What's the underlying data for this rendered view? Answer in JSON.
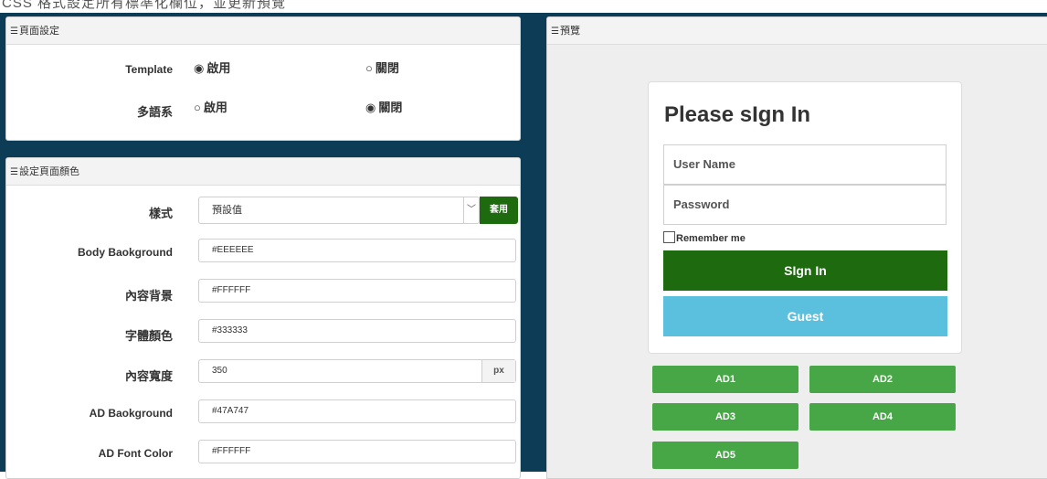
{
  "caption": "CSS 格式設定所有標準化欄位，並更新預覽",
  "page_settings": {
    "title": "頁面設定",
    "template_label": "Template",
    "template_options": [
      {
        "label": "啟用",
        "checked": true
      },
      {
        "label": "關閉",
        "checked": false
      }
    ],
    "multilang_label": "多語系",
    "multilang_options": [
      {
        "label": "啟用",
        "checked": false
      },
      {
        "label": "關閉",
        "checked": true
      }
    ]
  },
  "color_settings": {
    "title": "設定頁面顏色",
    "style_label": "樣式",
    "style_value": "預設值",
    "apply_label": "套用",
    "fields": [
      {
        "label": "Body Baokground",
        "value": "#EEEEEE"
      },
      {
        "label": "內容背景",
        "value": "#FFFFFF"
      },
      {
        "label": "字體顏色",
        "value": "#333333"
      },
      {
        "label": "內容寬度",
        "value": "350",
        "suffix": "px"
      },
      {
        "label": "AD Baokground",
        "value": "#47A747"
      },
      {
        "label": "AD Font Color",
        "value": "#FFFFFF"
      }
    ]
  },
  "preview": {
    "title": "預覽",
    "login": {
      "heading": "Please sIgn In",
      "username_placeholder": "User Name",
      "password_placeholder": "Password",
      "remember_label": "Remember me",
      "signin_label": "SIgn In",
      "guest_label": "Guest"
    },
    "ads": [
      "AD1",
      "AD2",
      "AD3",
      "AD4",
      "AD5"
    ]
  },
  "colors": {
    "sidebar_dark": "#0d3d56",
    "primary_green": "#1e6b0f",
    "guest_blue": "#5bc0de",
    "ad_green": "#47a747",
    "preview_bg": "#eeeeee"
  }
}
